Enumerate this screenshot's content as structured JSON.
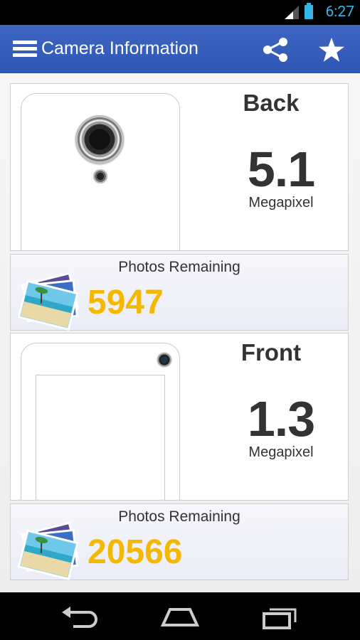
{
  "status_bar": {
    "time": "6:27",
    "accent": "#33b5e5"
  },
  "action_bar": {
    "title": "Camera Information",
    "menu_icon": "hamburger-menu-icon",
    "share_icon": "share-icon",
    "favorite_icon": "star-icon",
    "color": "#2f58b6"
  },
  "cameras": [
    {
      "title": "Back",
      "megapixels": "5.1",
      "unit": "Megapixel",
      "remaining_label": "Photos Remaining",
      "remaining_count": "5947"
    },
    {
      "title": "Front",
      "megapixels": "1.3",
      "unit": "Megapixel",
      "remaining_label": "Photos Remaining",
      "remaining_count": "20566"
    }
  ],
  "nav_bar": {
    "back_icon": "back-icon",
    "home_icon": "home-icon",
    "recents_icon": "recent-apps-icon"
  },
  "colors": {
    "count": "#f5b800"
  }
}
